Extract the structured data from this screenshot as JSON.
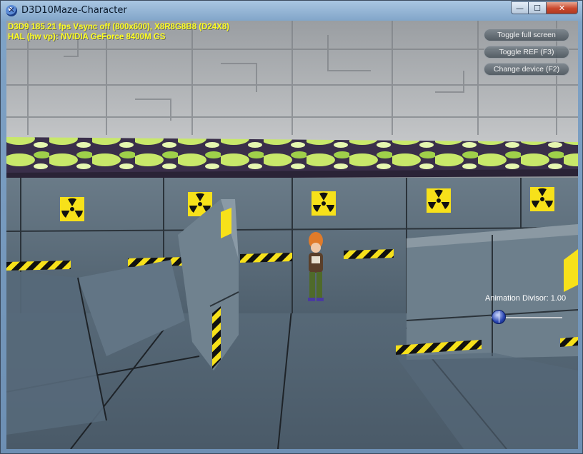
{
  "window": {
    "title": "D3D10Maze-Character",
    "minimize_glyph": "—",
    "maximize_glyph": "☐",
    "close_glyph": "✕"
  },
  "stats": {
    "line1": "D3D9 185.21 fps Vsync off (800x600), X8R8G8B8 (D24X8)",
    "line2": "HAL (hw vp): NVIDIA GeForce 8400M GS",
    "color": "#ffff20"
  },
  "hud": {
    "buttons": [
      {
        "label": "Toggle full screen"
      },
      {
        "label": "Toggle REF (F3)"
      },
      {
        "label": "Change device (F2)"
      }
    ],
    "slider": {
      "label": "Animation Divisor: 1.00",
      "value": 0.0
    }
  },
  "colors": {
    "hazard_yellow": "#f7e11a",
    "hazard_black": "#111111",
    "wall_steel": "#6b7e8c",
    "slime_green": "#c8e86a"
  }
}
